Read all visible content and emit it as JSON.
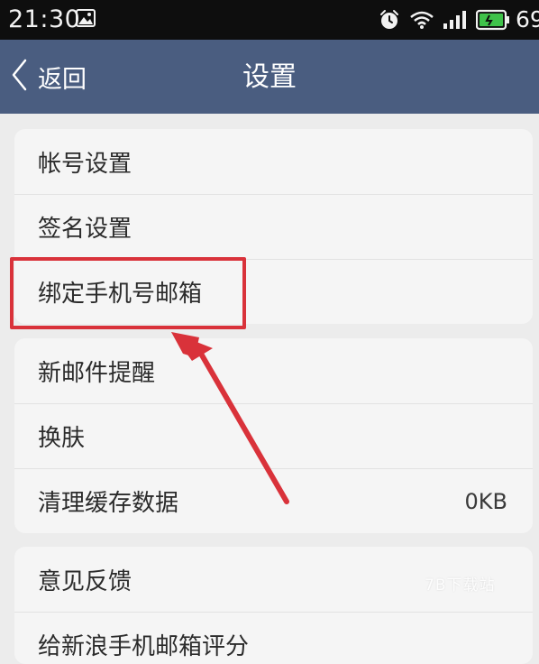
{
  "status_bar": {
    "time": "21:30",
    "battery_percent": "69"
  },
  "header": {
    "back_label": "返回",
    "title": "设置"
  },
  "groups": [
    {
      "items": [
        {
          "label": "帐号设置"
        },
        {
          "label": "签名设置"
        },
        {
          "label": "绑定手机号邮箱",
          "highlighted": true
        }
      ]
    },
    {
      "items": [
        {
          "label": "新邮件提醒"
        },
        {
          "label": "换肤"
        },
        {
          "label": "清理缓存数据",
          "value": "0KB"
        }
      ]
    },
    {
      "items": [
        {
          "label": "意见反馈"
        },
        {
          "label": "给新浪手机邮箱评分"
        }
      ]
    }
  ],
  "watermark": "7B下载站",
  "colors": {
    "title_bar": "#4a5d80",
    "status_bar": "#0e0e0e",
    "background": "#ececec",
    "card": "#f5f5f5",
    "highlight": "#d9323a"
  }
}
